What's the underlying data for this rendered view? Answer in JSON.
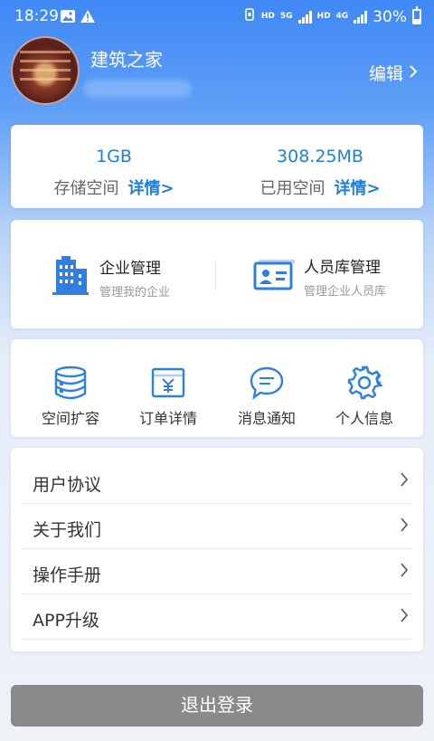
{
  "status_bar": {
    "time": "18:29",
    "network_labels": [
      "HD",
      "5G",
      "HD",
      "4G"
    ],
    "battery": "30%"
  },
  "profile": {
    "username": "建筑之家",
    "edit_label": "编辑"
  },
  "storage": {
    "total_value": "1GB",
    "total_label": "存储空间",
    "total_link": "详情>",
    "used_value": "308.25MB",
    "used_label": "已用空间",
    "used_link": "详情>"
  },
  "management": {
    "enterprise_title": "企业管理",
    "enterprise_subtitle": "管理我的企业",
    "personnel_title": "人员库管理",
    "personnel_subtitle": "管理企业人员库"
  },
  "quick_actions": [
    {
      "label": "空间扩容",
      "icon": "database-icon"
    },
    {
      "label": "订单详情",
      "icon": "order-yen-icon"
    },
    {
      "label": "消息通知",
      "icon": "message-bubble-icon"
    },
    {
      "label": "个人信息",
      "icon": "gear-icon"
    }
  ],
  "menu_items": [
    {
      "label": "用户协议"
    },
    {
      "label": "关于我们"
    },
    {
      "label": "操作手册"
    },
    {
      "label": "APP升级"
    }
  ],
  "logout_label": "退出登录",
  "colors": {
    "accent": "#1f7fd6",
    "header_blue": "#3f88f5",
    "logout_gray": "#8a8a8a"
  }
}
